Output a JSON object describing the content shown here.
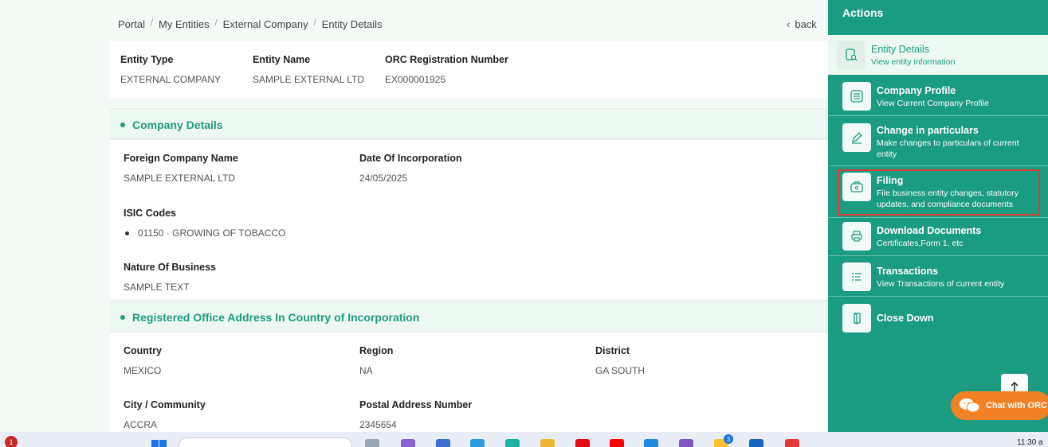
{
  "breadcrumb": [
    "Portal",
    "My Entities",
    "External Company",
    "Entity Details"
  ],
  "back_label": "back",
  "entity": {
    "type_label": "Entity Type",
    "type_value": "EXTERNAL COMPANY",
    "name_label": "Entity Name",
    "name_value": "SAMPLE EXTERNAL LTD",
    "orc_label": "ORC Registration Number",
    "orc_value": "EX000001925"
  },
  "company_details": {
    "title": "Company Details",
    "foreign_name_label": "Foreign Company Name",
    "foreign_name_value": "SAMPLE EXTERNAL LTD",
    "doi_label": "Date Of Incorporation",
    "doi_value": "24/05/2025",
    "isic_label": "ISIC Codes",
    "isic_items": [
      "01150 · GROWING OF TOBACCO"
    ],
    "nature_label": "Nature Of Business",
    "nature_value": "SAMPLE TEXT"
  },
  "registered_office": {
    "title": "Registered Office Address In Country of Incorporation",
    "country_label": "Country",
    "country_value": "MEXICO",
    "region_label": "Region",
    "region_value": "NA",
    "district_label": "District",
    "district_value": "GA SOUTH",
    "city_label": "City / Community",
    "city_value": "ACCRA",
    "postal_label": "Postal Address Number",
    "postal_value": "2345654"
  },
  "actions": {
    "title": "Actions",
    "items": [
      {
        "title": "Entity Details",
        "subtitle": "View entity information",
        "icon": "document-search-icon"
      },
      {
        "title": "Company Profile",
        "subtitle": "View Current Company Profile",
        "icon": "list-icon"
      },
      {
        "title": "Change in particulars",
        "subtitle": "Make changes to particulars of current entity",
        "icon": "pencil-icon"
      },
      {
        "title": "Filing",
        "subtitle": "File business entity changes, statutory updates, and compliance documents",
        "icon": "briefcase-icon"
      },
      {
        "title": "Download Documents",
        "subtitle": "Certificates,Form 1, etc",
        "icon": "printer-icon"
      },
      {
        "title": "Transactions",
        "subtitle": "View Transactions of current entity",
        "icon": "list-check-icon"
      },
      {
        "title": "Close Down",
        "subtitle": "",
        "icon": "door-icon"
      }
    ]
  },
  "chat_label": "Chat with ORC",
  "taskbar": {
    "notification_count": "1",
    "app_badge": "3",
    "clock": "11:30 a"
  },
  "colors": {
    "accent": "#1b9b80",
    "highlight": "#e23636",
    "chat": "#f08225"
  }
}
